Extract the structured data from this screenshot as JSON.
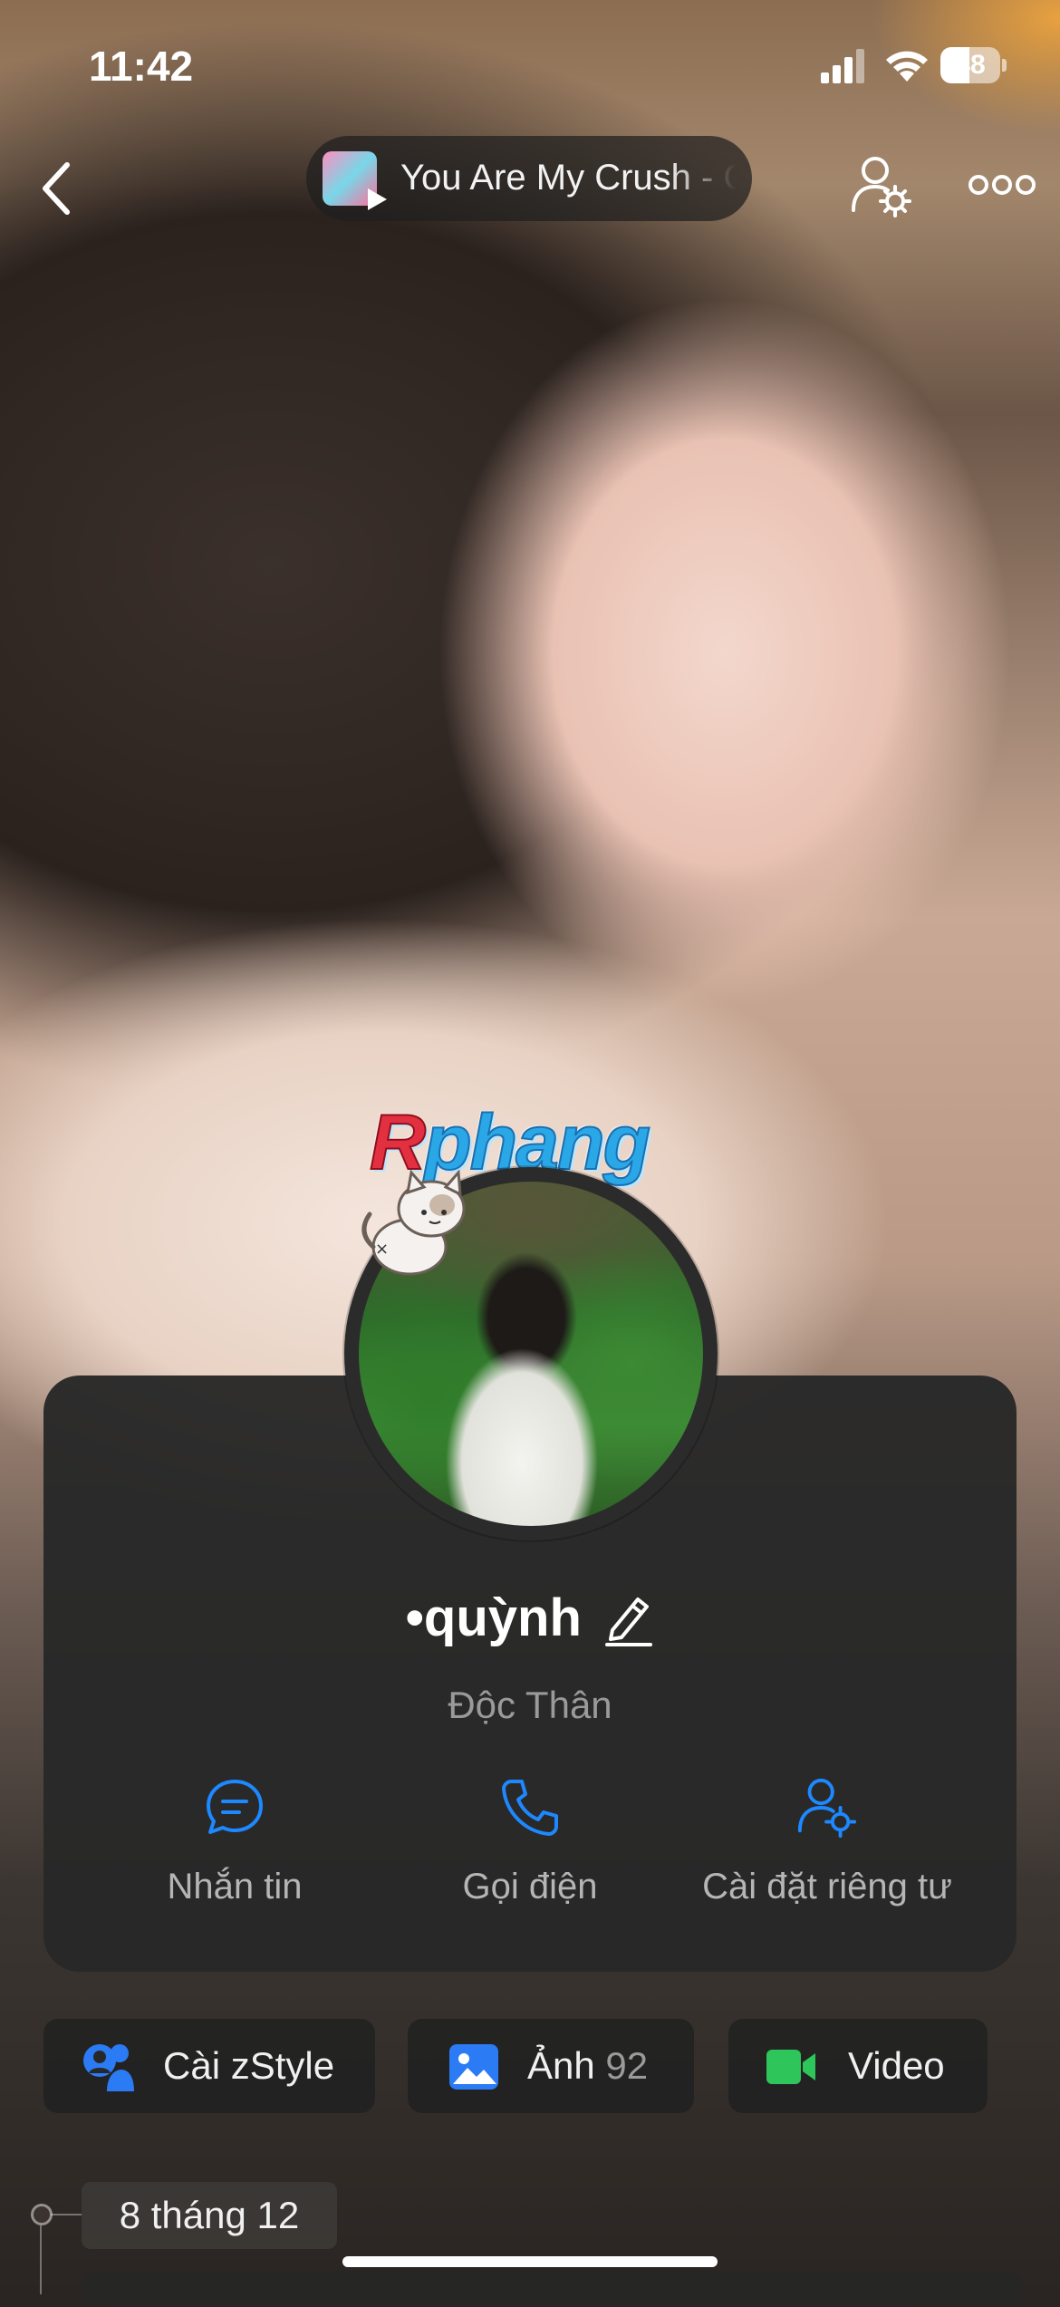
{
  "status_bar": {
    "time": "11:42",
    "battery": "48",
    "battery_level": 0.48
  },
  "header": {
    "music_title": "You Are My Crush - C"
  },
  "watermark": "Rphang",
  "profile": {
    "name": "•quỳnh",
    "status": "Độc Thân"
  },
  "actions": [
    {
      "label": "Nhắn tin",
      "icon": "chat-bubble-icon"
    },
    {
      "label": "Gọi điện",
      "icon": "phone-icon"
    },
    {
      "label": "Cài đặt riêng tư",
      "icon": "user-settings-icon"
    }
  ],
  "chips": {
    "zstyle": {
      "label": "Cài zStyle",
      "icon": "zstyle-icon"
    },
    "photos": {
      "label": "Ảnh",
      "count": "92",
      "icon": "image-icon"
    },
    "video": {
      "label": "Video",
      "icon": "video-camera-icon"
    }
  },
  "timeline": {
    "date": "8 tháng 12"
  },
  "colors": {
    "accent": "#1e88ff",
    "card_bg": "#282828",
    "video_green": "#2ec55a",
    "photo_blue": "#2a7bf4"
  }
}
